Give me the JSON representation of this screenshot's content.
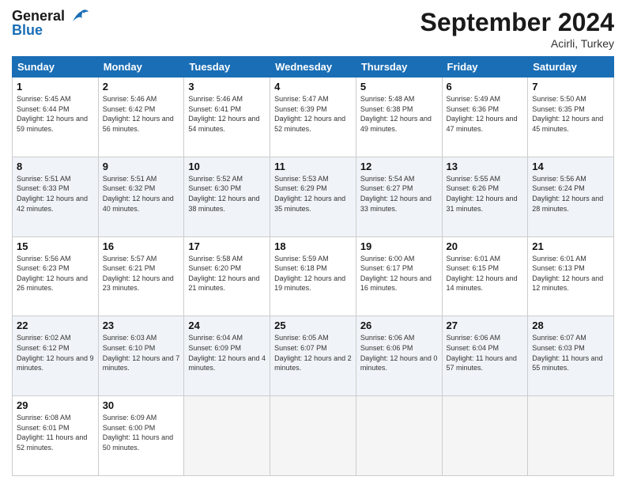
{
  "header": {
    "logo_line1": "General",
    "logo_line2": "Blue",
    "month_title": "September 2024",
    "location": "Acirli, Turkey"
  },
  "weekdays": [
    "Sunday",
    "Monday",
    "Tuesday",
    "Wednesday",
    "Thursday",
    "Friday",
    "Saturday"
  ],
  "weeks": [
    [
      {
        "day": "1",
        "rise": "5:45 AM",
        "set": "6:44 PM",
        "daylight": "12 hours and 59 minutes."
      },
      {
        "day": "2",
        "rise": "5:46 AM",
        "set": "6:42 PM",
        "daylight": "12 hours and 56 minutes."
      },
      {
        "day": "3",
        "rise": "5:46 AM",
        "set": "6:41 PM",
        "daylight": "12 hours and 54 minutes."
      },
      {
        "day": "4",
        "rise": "5:47 AM",
        "set": "6:39 PM",
        "daylight": "12 hours and 52 minutes."
      },
      {
        "day": "5",
        "rise": "5:48 AM",
        "set": "6:38 PM",
        "daylight": "12 hours and 49 minutes."
      },
      {
        "day": "6",
        "rise": "5:49 AM",
        "set": "6:36 PM",
        "daylight": "12 hours and 47 minutes."
      },
      {
        "day": "7",
        "rise": "5:50 AM",
        "set": "6:35 PM",
        "daylight": "12 hours and 45 minutes."
      }
    ],
    [
      {
        "day": "8",
        "rise": "5:51 AM",
        "set": "6:33 PM",
        "daylight": "12 hours and 42 minutes."
      },
      {
        "day": "9",
        "rise": "5:51 AM",
        "set": "6:32 PM",
        "daylight": "12 hours and 40 minutes."
      },
      {
        "day": "10",
        "rise": "5:52 AM",
        "set": "6:30 PM",
        "daylight": "12 hours and 38 minutes."
      },
      {
        "day": "11",
        "rise": "5:53 AM",
        "set": "6:29 PM",
        "daylight": "12 hours and 35 minutes."
      },
      {
        "day": "12",
        "rise": "5:54 AM",
        "set": "6:27 PM",
        "daylight": "12 hours and 33 minutes."
      },
      {
        "day": "13",
        "rise": "5:55 AM",
        "set": "6:26 PM",
        "daylight": "12 hours and 31 minutes."
      },
      {
        "day": "14",
        "rise": "5:56 AM",
        "set": "6:24 PM",
        "daylight": "12 hours and 28 minutes."
      }
    ],
    [
      {
        "day": "15",
        "rise": "5:56 AM",
        "set": "6:23 PM",
        "daylight": "12 hours and 26 minutes."
      },
      {
        "day": "16",
        "rise": "5:57 AM",
        "set": "6:21 PM",
        "daylight": "12 hours and 23 minutes."
      },
      {
        "day": "17",
        "rise": "5:58 AM",
        "set": "6:20 PM",
        "daylight": "12 hours and 21 minutes."
      },
      {
        "day": "18",
        "rise": "5:59 AM",
        "set": "6:18 PM",
        "daylight": "12 hours and 19 minutes."
      },
      {
        "day": "19",
        "rise": "6:00 AM",
        "set": "6:17 PM",
        "daylight": "12 hours and 16 minutes."
      },
      {
        "day": "20",
        "rise": "6:01 AM",
        "set": "6:15 PM",
        "daylight": "12 hours and 14 minutes."
      },
      {
        "day": "21",
        "rise": "6:01 AM",
        "set": "6:13 PM",
        "daylight": "12 hours and 12 minutes."
      }
    ],
    [
      {
        "day": "22",
        "rise": "6:02 AM",
        "set": "6:12 PM",
        "daylight": "12 hours and 9 minutes."
      },
      {
        "day": "23",
        "rise": "6:03 AM",
        "set": "6:10 PM",
        "daylight": "12 hours and 7 minutes."
      },
      {
        "day": "24",
        "rise": "6:04 AM",
        "set": "6:09 PM",
        "daylight": "12 hours and 4 minutes."
      },
      {
        "day": "25",
        "rise": "6:05 AM",
        "set": "6:07 PM",
        "daylight": "12 hours and 2 minutes."
      },
      {
        "day": "26",
        "rise": "6:06 AM",
        "set": "6:06 PM",
        "daylight": "12 hours and 0 minutes."
      },
      {
        "day": "27",
        "rise": "6:06 AM",
        "set": "6:04 PM",
        "daylight": "11 hours and 57 minutes."
      },
      {
        "day": "28",
        "rise": "6:07 AM",
        "set": "6:03 PM",
        "daylight": "11 hours and 55 minutes."
      }
    ],
    [
      {
        "day": "29",
        "rise": "6:08 AM",
        "set": "6:01 PM",
        "daylight": "11 hours and 52 minutes."
      },
      {
        "day": "30",
        "rise": "6:09 AM",
        "set": "6:00 PM",
        "daylight": "11 hours and 50 minutes."
      },
      null,
      null,
      null,
      null,
      null
    ]
  ]
}
